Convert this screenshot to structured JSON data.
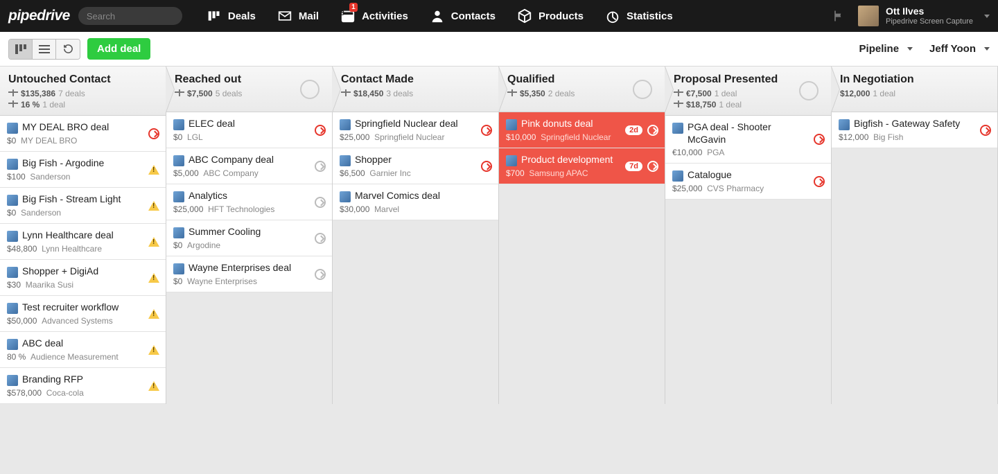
{
  "header": {
    "logo": "pipedrive",
    "searchPlaceholder": "Search",
    "nav": [
      {
        "key": "deals",
        "label": "Deals"
      },
      {
        "key": "mail",
        "label": "Mail"
      },
      {
        "key": "activities",
        "label": "Activities",
        "badge": "1",
        "calDay": "8"
      },
      {
        "key": "contacts",
        "label": "Contacts"
      },
      {
        "key": "products",
        "label": "Products"
      },
      {
        "key": "statistics",
        "label": "Statistics"
      }
    ],
    "user": {
      "name": "Ott Ilves",
      "sub": "Pipedrive Screen Capture"
    }
  },
  "toolbar": {
    "addDeal": "Add deal",
    "pipelineLabel": "Pipeline",
    "ownerLabel": "Jeff Yoon"
  },
  "columns": [
    {
      "title": "Untouched Contact",
      "stats": [
        {
          "value": "$135,386",
          "deals": "7 deals"
        },
        {
          "value": "16 %",
          "deals": "1 deal"
        }
      ],
      "showRot": false,
      "cards": [
        {
          "title": "MY DEAL BRO deal",
          "amount": "$0",
          "org": "MY DEAL BRO",
          "status": "red"
        },
        {
          "title": "Big Fish - Argodine",
          "amount": "$100",
          "org": "Sanderson",
          "status": "warn"
        },
        {
          "title": "Big Fish - Stream Light",
          "amount": "$0",
          "org": "Sanderson",
          "status": "warn"
        },
        {
          "title": "Lynn Healthcare deal",
          "amount": "$48,800",
          "org": "Lynn Healthcare",
          "status": "warn"
        },
        {
          "title": "Shopper + DigiAd",
          "amount": "$30",
          "org": "Maarika Susi",
          "status": "warn"
        },
        {
          "title": "Test recruiter workflow",
          "amount": "$50,000",
          "org": "Advanced Systems",
          "status": "warn"
        },
        {
          "title": "ABC deal",
          "amount": "80 %",
          "org": "Audience Measurement",
          "status": "warn"
        },
        {
          "title": "Branding RFP",
          "amount": "$578,000",
          "org": "Coca-cola",
          "status": "warn"
        }
      ]
    },
    {
      "title": "Reached out",
      "stats": [
        {
          "value": "$7,500",
          "deals": "5 deals"
        }
      ],
      "showRot": true,
      "cards": [
        {
          "title": "ELEC deal",
          "amount": "$0",
          "org": "LGL",
          "status": "red"
        },
        {
          "title": "ABC Company deal",
          "amount": "$5,000",
          "org": "ABC Company",
          "status": "gray"
        },
        {
          "title": "Analytics",
          "amount": "$25,000",
          "org": "HFT Technologies",
          "status": "gray"
        },
        {
          "title": "Summer Cooling",
          "amount": "$0",
          "org": "Argodine",
          "status": "gray"
        },
        {
          "title": "Wayne Enterprises deal",
          "amount": "$0",
          "org": "Wayne Enterprises",
          "status": "gray"
        }
      ]
    },
    {
      "title": "Contact Made",
      "stats": [
        {
          "value": "$18,450",
          "deals": "3 deals"
        }
      ],
      "showRot": false,
      "cards": [
        {
          "title": "Springfield Nuclear deal",
          "amount": "$25,000",
          "org": "Springfield Nuclear",
          "status": "red"
        },
        {
          "title": "Shopper",
          "amount": "$6,500",
          "org": "Garnier Inc",
          "status": "red"
        },
        {
          "title": "Marvel Comics deal",
          "amount": "$30,000",
          "org": "Marvel",
          "status": ""
        }
      ]
    },
    {
      "title": "Qualified",
      "stats": [
        {
          "value": "$5,350",
          "deals": "2 deals"
        }
      ],
      "showRot": true,
      "cards": [
        {
          "title": "Pink donuts deal",
          "amount": "$10,000",
          "org": "Springfield Nuclear",
          "status": "red",
          "highlight": true,
          "age": "2d"
        },
        {
          "title": "Product development",
          "amount": "$700",
          "org": "Samsung APAC",
          "status": "red",
          "highlight": true,
          "age": "7d"
        }
      ]
    },
    {
      "title": "Proposal Presented",
      "stats": [
        {
          "value": "€7,500",
          "deals": "1 deal"
        },
        {
          "value": "$18,750",
          "deals": "1 deal"
        }
      ],
      "showRot": true,
      "cards": [
        {
          "title": "PGA deal - Shooter McGavin",
          "amount": "€10,000",
          "org": "PGA",
          "status": "red"
        },
        {
          "title": "Catalogue",
          "amount": "$25,000",
          "org": "CVS Pharmacy",
          "status": "red"
        }
      ]
    },
    {
      "title": "In Negotiation",
      "stats": [
        {
          "value": "$12,000",
          "deals": "1 deal",
          "noscale": true
        }
      ],
      "showRot": false,
      "cards": [
        {
          "title": "Bigfish - Gateway Safety",
          "amount": "$12,000",
          "org": "Big Fish",
          "status": "red"
        }
      ]
    }
  ]
}
